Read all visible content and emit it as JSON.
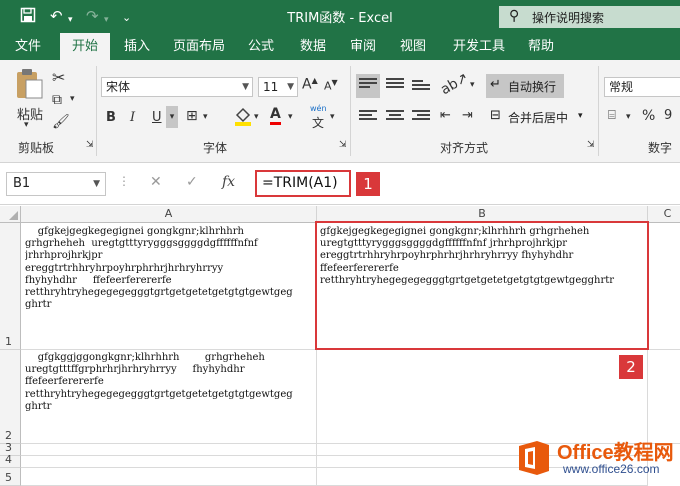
{
  "title_bar": {
    "title": "TRIM函数  -  Excel",
    "search_placeholder": "操作说明搜索"
  },
  "tabs": [
    "文件",
    "开始",
    "插入",
    "页面布局",
    "公式",
    "数据",
    "审阅",
    "视图",
    "开发工具",
    "帮助"
  ],
  "active_tab": "开始",
  "ribbon": {
    "paste_label": "粘贴",
    "font_name": "宋体",
    "font_size": "11",
    "bold": "B",
    "italic": "I",
    "underline": "U",
    "font_color_glyph": "A",
    "phonetic_top": "wén",
    "phonetic_bottom": "文",
    "wrap_text": "自动换行",
    "merge_center": "合并后居中",
    "number_format": "常规",
    "percent": "%",
    "groups": {
      "clipboard": "剪贴板",
      "font": "字体",
      "alignment": "对齐方式",
      "number": "数字"
    }
  },
  "formula_bar": {
    "name_box": "B1",
    "fx": "fx",
    "formula": "=TRIM(A1)"
  },
  "callouts": [
    "1",
    "2"
  ],
  "columns": [
    "A",
    "B",
    "C"
  ],
  "rows": [
    "1",
    "2",
    "3",
    "4",
    "5"
  ],
  "cells": {
    "A1": "    gfgkejgegkegegignei gongkgnr;klhrhhrh\ngrhgrheheh  uregtgtttyrygggsggggdgffffffnfnf\njrhrhprojhrkjpr\nereggtrtrhhryhrpoyhrphrhrjhrhryhrryy\nfhyhyhdhr     ffefeerferererfe\nretthryhtryhegegegegggtgrtgetgetetgetgtgtgewtgeg\nghrtr",
    "B1": "gfgkejgegkegegignei gongkgnr;klhrhhrh grhgrheheh\nuregtgtttyrygggsggggdgffffffnfnf jrhrhprojhrkjpr\nereggtrtrhhryhrpoyhrphrhrjhrhryhrryy fhyhyhdhr\nffefeerferererfe\nretthryhtryhegegegegggtgrtgetgetetgetgtgtgewtgegghrtr",
    "A2": "    gfgkggjggongkgnr;klhrhhrh        grhgrheheh\nuregtgtttffgrphrhrjhrhryhrryy     fhyhyhdhr\nffefeerferererfe\nretthryhtryhegegegegggtgrtgetgetetgetgtgtgewtgeg\nghrtr"
  },
  "watermark": {
    "line1": "Office教程网",
    "line2": "www.office26.com"
  },
  "colors": {
    "excel_green": "#217346",
    "highlight_red": "#d9383a",
    "watermark_orange": "#e8590c"
  }
}
